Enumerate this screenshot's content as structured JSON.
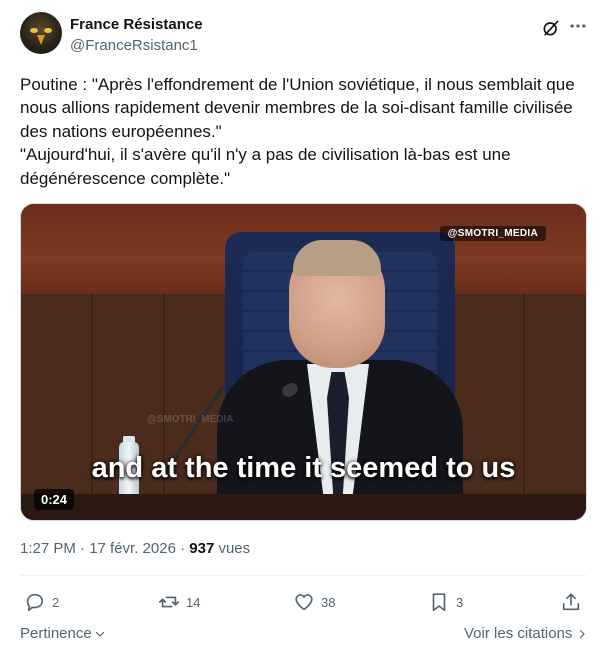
{
  "author": {
    "name": "France Résistance",
    "handle": "@FranceRsistanc1"
  },
  "tweet": {
    "paragraphs": [
      "Poutine : \"Après l'effondrement de l'Union soviétique, il nous semblait que nous allions rapidement devenir membres de la soi-disant famille civilisée des nations européennes.\"",
      "\"Aujourd'hui, il s'avère qu'il n'y a pas de civilisation là-bas est une dégénérescence complète.\""
    ]
  },
  "video": {
    "watermark": "@SMOTRI_MEDIA",
    "faint_watermark": "@SMOTRI_MEDIA",
    "subtitle": "and at the time it seemed to us",
    "duration": "0:24"
  },
  "meta": {
    "timestamp": "1:27 PM · 17 févr. 2026 · ",
    "views_count": "937",
    "views_label": " vues"
  },
  "actions": {
    "replies": "2",
    "reposts": "14",
    "likes": "38",
    "bookmarks": "3"
  },
  "footer": {
    "relevance": "Pertinence",
    "quotes": "Voir les citations"
  },
  "icons": [
    "grok-icon",
    "more-icon",
    "reply-icon",
    "retweet-icon",
    "like-icon",
    "bookmark-icon",
    "share-icon",
    "chevron-down-icon",
    "chevron-right-icon"
  ],
  "colors": {
    "text": "#0f1419",
    "secondary": "#536471",
    "divider": "#eff3f4"
  }
}
